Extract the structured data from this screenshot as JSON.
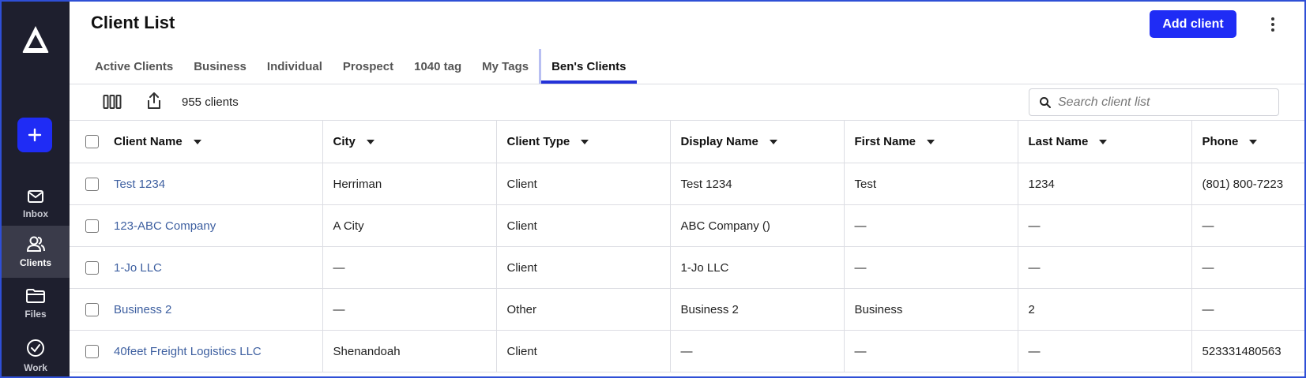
{
  "sidebar": {
    "nav": [
      {
        "label": "Inbox",
        "icon": "mail-icon"
      },
      {
        "label": "Clients",
        "icon": "users-icon"
      },
      {
        "label": "Files",
        "icon": "folder-icon"
      },
      {
        "label": "Work",
        "icon": "check-circle-icon"
      }
    ]
  },
  "header": {
    "title": "Client List",
    "add_label": "Add client"
  },
  "tabs": [
    "Active Clients",
    "Business",
    "Individual",
    "Prospect",
    "1040 tag",
    "My Tags",
    "Ben's Clients"
  ],
  "active_tab": "Ben's Clients",
  "toolbar": {
    "count": "955 clients",
    "search_placeholder": "Search client list"
  },
  "table": {
    "columns": [
      "Client Name",
      "City",
      "Client Type",
      "Display Name",
      "First Name",
      "Last Name",
      "Phone"
    ],
    "rows": [
      [
        "Test 1234",
        "Herriman",
        "Client",
        "Test 1234",
        "Test",
        "1234",
        "(801) 800-7223"
      ],
      [
        "123-ABC Company",
        "A City",
        "Client",
        "ABC Company ()",
        "—",
        "—",
        "—"
      ],
      [
        "1-Jo LLC",
        "—",
        "Client",
        "1-Jo LLC",
        "—",
        "—",
        "—"
      ],
      [
        "Business 2",
        "—",
        "Other",
        "Business 2",
        "Business",
        "2",
        "—"
      ],
      [
        "40feet Freight Logistics LLC",
        "Shenandoah",
        "Client",
        "—",
        "—",
        "—",
        "523331480563"
      ]
    ]
  },
  "colors": {
    "accent": "#1f2cf5",
    "sidebar_bg": "#1e1f2e",
    "link": "#3d5fa0"
  }
}
